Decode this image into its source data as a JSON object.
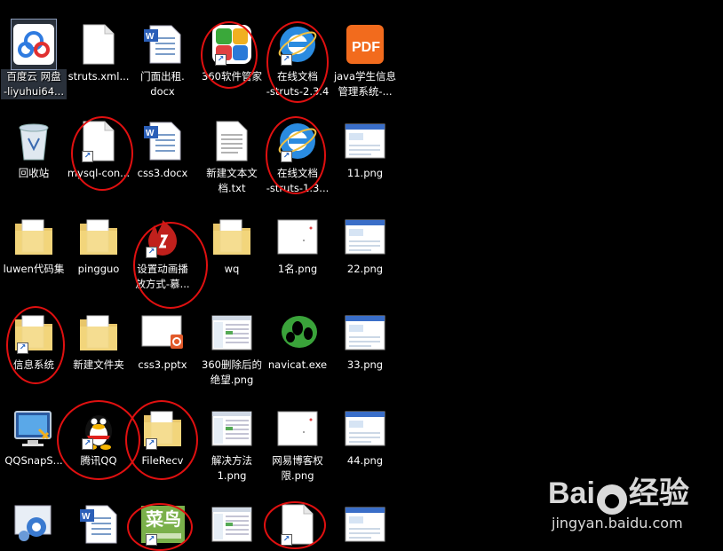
{
  "desktop": {
    "rows": [
      [
        {
          "name": "baiduyun-icon",
          "label": "百度云 网盘\n-liyuhui64...",
          "kind": "baiduyun",
          "shortcut": false,
          "selected": true
        },
        {
          "name": "struts-xml-icon",
          "label": "struts.xml...",
          "kind": "doc-blank",
          "shortcut": false
        },
        {
          "name": "word-doc-icon",
          "label": "门面出租.\ndocx",
          "kind": "word",
          "shortcut": false
        },
        {
          "name": "360-manager-icon",
          "label": "360软件管家",
          "kind": "tiles",
          "shortcut": true
        },
        {
          "name": "online-doc-icon",
          "label": "在线文档\n-struts-2.3.4",
          "kind": "ie",
          "shortcut": true
        },
        {
          "name": "pdf-icon",
          "label": "java学生信息\n管理系统-...",
          "kind": "pdf",
          "shortcut": false
        }
      ],
      [
        {
          "name": "recycle-bin-icon",
          "label": "回收站",
          "kind": "bin",
          "shortcut": false
        },
        {
          "name": "mysql-shortcut-icon",
          "label": "mysql-con...",
          "kind": "doc-blank",
          "shortcut": true
        },
        {
          "name": "word-doc-icon",
          "label": "css3.docx",
          "kind": "word",
          "shortcut": false
        },
        {
          "name": "text-file-icon",
          "label": "新建文本文\n档.txt",
          "kind": "txt",
          "shortcut": false
        },
        {
          "name": "online-doc-icon",
          "label": "在线文档\n-struts-1.3...",
          "kind": "ie",
          "shortcut": true
        },
        {
          "name": "image-file-icon",
          "label": "11.png",
          "kind": "png-screen",
          "shortcut": false
        }
      ],
      [
        {
          "name": "folder-icon",
          "label": "luwen代码集",
          "kind": "folder",
          "shortcut": false
        },
        {
          "name": "folder-icon",
          "label": "pingguo",
          "kind": "folder",
          "shortcut": false
        },
        {
          "name": "flash-shortcut-icon",
          "label": "设置动画播\n放方式-慕...",
          "kind": "flash",
          "shortcut": true
        },
        {
          "name": "folder-icon",
          "label": "wq",
          "kind": "folder",
          "shortcut": false
        },
        {
          "name": "image-file-icon",
          "label": "1名.png",
          "kind": "png-white",
          "shortcut": false
        },
        {
          "name": "image-file-icon",
          "label": "22.png",
          "kind": "png-screen",
          "shortcut": false
        }
      ],
      [
        {
          "name": "folder-shortcut-icon",
          "label": "信息系统",
          "kind": "folder",
          "shortcut": true
        },
        {
          "name": "folder-icon",
          "label": "新建文件夹",
          "kind": "folder",
          "shortcut": false
        },
        {
          "name": "pptx-icon",
          "label": "css3.pptx",
          "kind": "pptx",
          "shortcut": false
        },
        {
          "name": "image-file-icon",
          "label": "360删除后的\n绝望.png",
          "kind": "png-list",
          "shortcut": false
        },
        {
          "name": "navicat-icon",
          "label": "navicat.exe",
          "kind": "navicat",
          "shortcut": false
        },
        {
          "name": "image-file-icon",
          "label": "33.png",
          "kind": "png-screen",
          "shortcut": false
        }
      ],
      [
        {
          "name": "qqsnapshot-icon",
          "label": "QQSnapS...",
          "kind": "monitor",
          "shortcut": false
        },
        {
          "name": "qq-icon",
          "label": "腾讯QQ",
          "kind": "qq",
          "shortcut": true
        },
        {
          "name": "filerecv-icon",
          "label": "FileRecv",
          "kind": "folder",
          "shortcut": true
        },
        {
          "name": "image-file-icon",
          "label": "解决方法\n1.png",
          "kind": "png-list",
          "shortcut": false
        },
        {
          "name": "image-file-icon",
          "label": "网易博客权\n限.png",
          "kind": "png-white",
          "shortcut": false
        },
        {
          "name": "image-file-icon",
          "label": "44.png",
          "kind": "png-screen",
          "shortcut": false
        }
      ],
      [
        {
          "name": "settings-icon",
          "label": "",
          "kind": "gear",
          "shortcut": false
        },
        {
          "name": "word-doc-icon",
          "label": "",
          "kind": "word",
          "shortcut": false
        },
        {
          "name": "runoob-icon",
          "label": "",
          "kind": "runoob",
          "shortcut": true
        },
        {
          "name": "image-file-icon",
          "label": "",
          "kind": "png-list",
          "shortcut": false
        },
        {
          "name": "blank-shortcut-icon",
          "label": "",
          "kind": "doc-blank",
          "shortcut": true
        },
        {
          "name": "image-file-icon",
          "label": "",
          "kind": "png-screen",
          "shortcut": false
        }
      ]
    ]
  },
  "runoob_text": "菜鸟",
  "watermark": {
    "brand_left": "Bai",
    "brand_right": "经验",
    "url": "jingyan.baidu.com"
  },
  "colors": {
    "highlight": "#e01010",
    "background": "#000000"
  }
}
